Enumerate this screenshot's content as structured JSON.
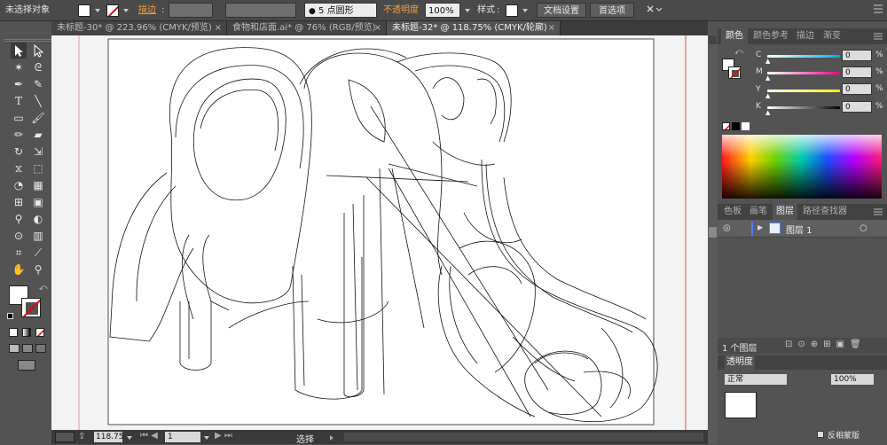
{
  "control_bar": {
    "selection_label": "未选择对象",
    "stroke_label": "描边",
    "brush_label": "5 点圆形",
    "opacity_label": "不透明度",
    "opacity_value": "100%",
    "style_label": "样式",
    "doc_setup_label": "文档设置",
    "prefs_label": "首选项"
  },
  "tabs": [
    {
      "label": "未标题-30* @ 223.96% (CMYK/预览)"
    },
    {
      "label": "食物和店面.ai* @ 76% (RGB/预览)"
    },
    {
      "label": "未标题-32* @ 118.75% (CMYK/轮廓)",
      "active": true
    }
  ],
  "status_bar": {
    "zoom": "118.75",
    "artboard": "1",
    "mode_label": "选择"
  },
  "color_panel": {
    "tabs": [
      "颜色",
      "颜色参考",
      "描边",
      "渐变"
    ],
    "channels": [
      {
        "name": "C",
        "value": "0",
        "unit": "%",
        "color": "#00aeef"
      },
      {
        "name": "M",
        "value": "0",
        "unit": "%",
        "color": "#ec008c"
      },
      {
        "name": "Y",
        "value": "0",
        "unit": "%",
        "color": "#fff200"
      },
      {
        "name": "K",
        "value": "0",
        "unit": "%",
        "color": "#000000"
      }
    ]
  },
  "layers_panel": {
    "tabs": [
      "色板",
      "画笔",
      "图层",
      "路径查找器"
    ],
    "layers": [
      {
        "name": "图层 1",
        "color": "#4f7bff"
      }
    ],
    "count_label": "1 个图层"
  },
  "transparency_panel": {
    "tab": "透明度",
    "value": "100%",
    "blend_label": "正常"
  },
  "invert_mask_label": "反相蒙版"
}
